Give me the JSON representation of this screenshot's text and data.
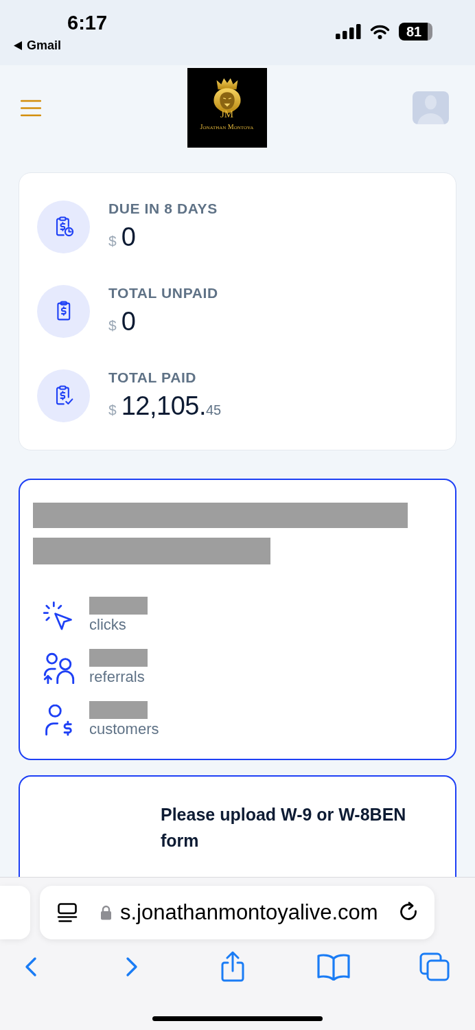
{
  "status_bar": {
    "time": "6:17",
    "back_label": "Gmail",
    "battery": "81"
  },
  "header": {
    "logo_monogram": "JM",
    "logo_name": "Jonathan Montoya"
  },
  "balance_card": {
    "items": [
      {
        "kind": "due",
        "label": "DUE IN 8 DAYS",
        "currency": "$",
        "amount": "0"
      },
      {
        "kind": "unpaid",
        "label": "TOTAL UNPAID",
        "currency": "$",
        "amount": "0"
      },
      {
        "kind": "paid",
        "label": "TOTAL PAID",
        "currency": "$",
        "amount": "12,105.",
        "cents": "45"
      }
    ]
  },
  "referral_card": {
    "heading_redacted": true,
    "stats": [
      {
        "kind": "clicks",
        "label": "clicks",
        "count_redacted": true
      },
      {
        "kind": "referrals",
        "label": "referrals",
        "count_redacted": true
      },
      {
        "kind": "customers",
        "label": "customers",
        "count_redacted": true
      }
    ]
  },
  "notice_card": {
    "message": "Please upload W-9 or W-8BEN form"
  },
  "browser_bar": {
    "url": "s.jonathanmontoyalive.com"
  }
}
